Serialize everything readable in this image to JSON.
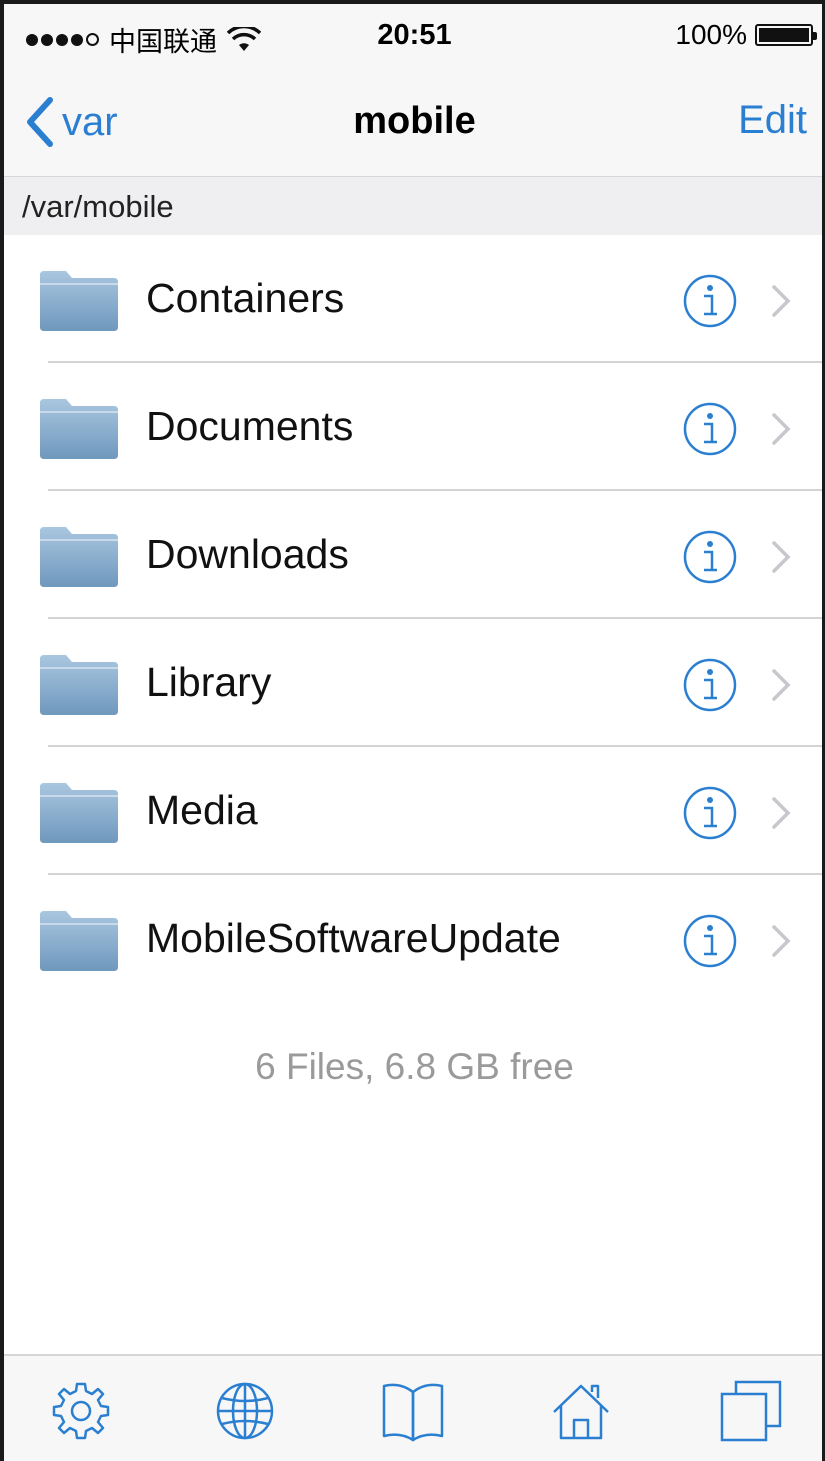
{
  "status_bar": {
    "carrier": "中国联通",
    "time": "20:51",
    "battery_percent": "100%",
    "signal_bars_filled": 4,
    "signal_bars_total": 5
  },
  "nav": {
    "back_label": "var",
    "title": "mobile",
    "edit_label": "Edit"
  },
  "path": "/var/mobile",
  "folders": [
    {
      "name": "Containers"
    },
    {
      "name": "Documents"
    },
    {
      "name": "Downloads"
    },
    {
      "name": "Library"
    },
    {
      "name": "Media"
    },
    {
      "name": "MobileSoftwareUpdate"
    }
  ],
  "summary": "6 Files, 6.8 GB free",
  "toolbar": {
    "items": [
      "gear-icon",
      "globe-icon",
      "book-icon",
      "home-icon",
      "windows-icon"
    ]
  },
  "colors": {
    "accent": "#2b7fd1",
    "folder": "#8fb3d3",
    "muted": "#9a9a9a"
  }
}
